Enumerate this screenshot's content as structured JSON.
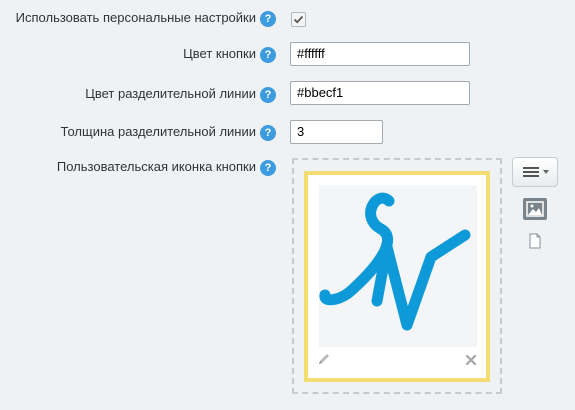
{
  "fields": [
    {
      "label": "Использовать персональные настройки",
      "type": "checkbox",
      "checked": true
    },
    {
      "label": "Цвет кнопки",
      "type": "text",
      "value": "#ffffff"
    },
    {
      "label": "Цвет разделительной линии",
      "type": "text",
      "value": "#bbecf1"
    },
    {
      "label": "Толщина разделительной линии",
      "type": "text",
      "value": "3"
    },
    {
      "label": "Пользовательская иконка кнопки",
      "type": "image"
    }
  ],
  "help_glyph": "?",
  "icons": {
    "help": "question-mark-icon",
    "edit": "pencil-icon",
    "delete": "close-icon",
    "menu": "hamburger-menu-icon",
    "image_mode": "image-icon",
    "file_mode": "file-icon"
  },
  "colors": {
    "background": "#eef2f4",
    "help": "#3d9be0",
    "frame": "#f3dd72",
    "logo": "#0e9ad8"
  }
}
